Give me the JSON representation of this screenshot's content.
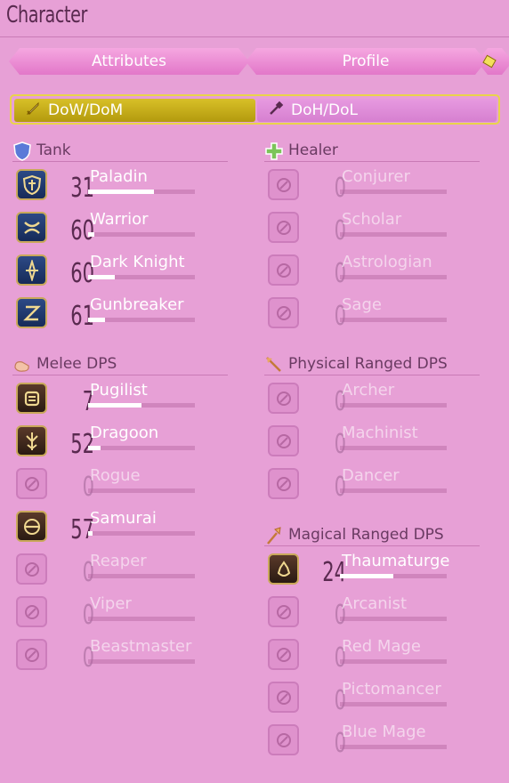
{
  "window": {
    "title": "Character"
  },
  "tabs": [
    {
      "label": "Attributes"
    },
    {
      "label": "Profile"
    }
  ],
  "role_tabs": [
    {
      "label": "DoW/DoM",
      "selected": true
    },
    {
      "label": "DoH/DoL",
      "selected": false
    }
  ],
  "sections": {
    "tank": {
      "title": "Tank",
      "jobs": [
        {
          "name": "Paladin",
          "level": "31",
          "progress": 0.62,
          "icon": "paladin-icon"
        },
        {
          "name": "Warrior",
          "level": "60",
          "progress": 0.06,
          "icon": "warrior-icon"
        },
        {
          "name": "Dark Knight",
          "level": "60",
          "progress": 0.25,
          "icon": "dark-knight-icon"
        },
        {
          "name": "Gunbreaker",
          "level": "61",
          "progress": 0.16,
          "icon": "gunbreaker-icon"
        }
      ]
    },
    "healer": {
      "title": "Healer",
      "jobs": [
        {
          "name": "Conjurer",
          "level": "0",
          "progress": 0,
          "icon": "conjurer-icon"
        },
        {
          "name": "Scholar",
          "level": "0",
          "progress": 0,
          "icon": "scholar-icon"
        },
        {
          "name": "Astrologian",
          "level": "0",
          "progress": 0,
          "icon": "astrologian-icon"
        },
        {
          "name": "Sage",
          "level": "0",
          "progress": 0,
          "icon": "sage-icon"
        }
      ]
    },
    "melee": {
      "title": "Melee DPS",
      "jobs": [
        {
          "name": "Pugilist",
          "level": "7",
          "progress": 0.5,
          "icon": "pugilist-icon"
        },
        {
          "name": "Dragoon",
          "level": "52",
          "progress": 0.12,
          "icon": "dragoon-icon"
        },
        {
          "name": "Rogue",
          "level": "0",
          "progress": 0,
          "icon": "rogue-icon"
        },
        {
          "name": "Samurai",
          "level": "57",
          "progress": 0.04,
          "icon": "samurai-icon"
        },
        {
          "name": "Reaper",
          "level": "0",
          "progress": 0,
          "icon": "reaper-icon"
        },
        {
          "name": "Viper",
          "level": "0",
          "progress": 0,
          "icon": "viper-icon"
        },
        {
          "name": "Beastmaster",
          "level": "0",
          "progress": 0,
          "icon": "beastmaster-icon"
        }
      ]
    },
    "phys_ranged": {
      "title": "Physical Ranged DPS",
      "jobs": [
        {
          "name": "Archer",
          "level": "0",
          "progress": 0,
          "icon": "archer-icon"
        },
        {
          "name": "Machinist",
          "level": "0",
          "progress": 0,
          "icon": "machinist-icon"
        },
        {
          "name": "Dancer",
          "level": "0",
          "progress": 0,
          "icon": "dancer-icon"
        }
      ]
    },
    "magic_ranged": {
      "title": "Magical Ranged DPS",
      "jobs": [
        {
          "name": "Thaumaturge",
          "level": "24",
          "progress": 0.5,
          "icon": "thaumaturge-icon"
        },
        {
          "name": "Arcanist",
          "level": "0",
          "progress": 0,
          "icon": "arcanist-icon"
        },
        {
          "name": "Red Mage",
          "level": "0",
          "progress": 0,
          "icon": "red-mage-icon"
        },
        {
          "name": "Pictomancer",
          "level": "0",
          "progress": 0,
          "icon": "pictomancer-icon"
        },
        {
          "name": "Blue Mage",
          "level": "0",
          "progress": 0,
          "icon": "blue-mage-icon"
        }
      ]
    }
  },
  "colors": {
    "background": "#e7a0d6",
    "selected_role_tab": "#d8c028",
    "tank_icon_bg": "#2d4a86",
    "title_text": "#5a2a50"
  }
}
